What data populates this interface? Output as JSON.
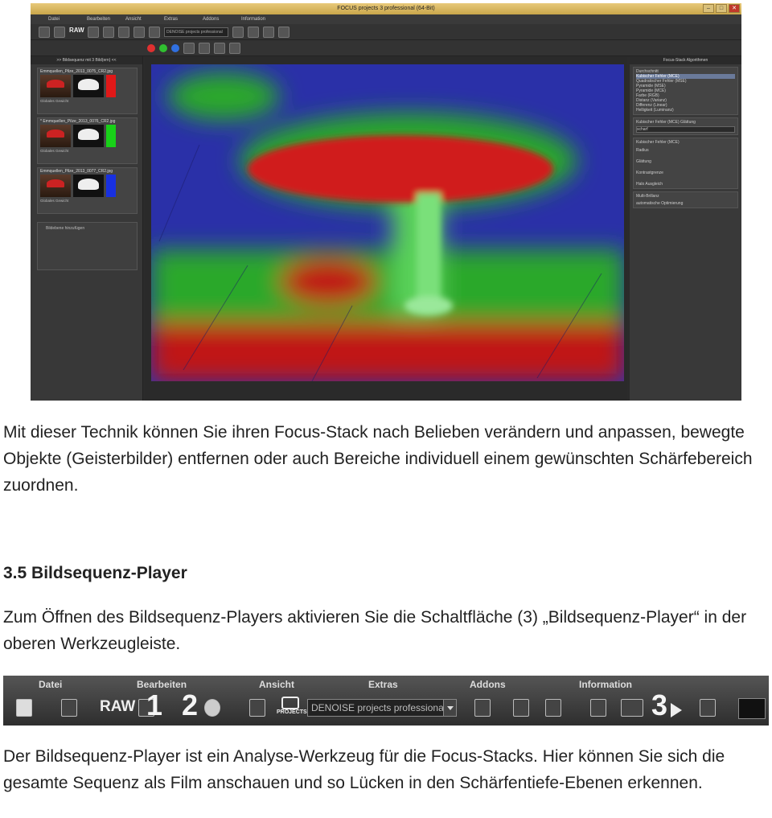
{
  "app": {
    "title": "FOCUS projects 3 professional (64-Bit)",
    "menu": [
      "Datei",
      "Bearbeiten",
      "Ansicht",
      "Extras",
      "Addons",
      "Information"
    ],
    "toolbar_raw": "RAW",
    "toolbar_denoise": "DENOISE projects professional",
    "left_panel_title": ">> Bildsequenz mit 3 Bild(ern) <<",
    "layers": [
      {
        "name": "Emmquellen_Pilze_2013_0075_CR2.jpg",
        "weight_label": "Globales Gewicht",
        "weight": "100",
        "left": "schwach",
        "right": "stark",
        "swatch": "#e01818"
      },
      {
        "name": "* Emmquellen_Pilze_2013_0076_CR2.jpg",
        "weight_label": "Globales Gewicht",
        "weight": "100",
        "left": "schwach",
        "right": "stark",
        "swatch": "#18d018"
      },
      {
        "name": "Emmquellen_Pilze_2013_0077_CR2.jpg",
        "weight_label": "Globales Gewicht",
        "weight": "100",
        "left": "schwach",
        "right": "stark",
        "swatch": "#1830e0"
      }
    ],
    "add_layer": "Bildebene hinzufügen",
    "right_panel_title": "Focus-Stack Algorithmen",
    "algorithms": [
      "Durchschnitt",
      "Kubischer Fehler (MCE)",
      "Quadratischer Fehler (MSE)",
      "Pyramide (MSE)",
      "Pyramide (MCE)",
      "Farbe (RGB)",
      "Distanz (Varianz)",
      "Differenz (Linear)",
      "Helligkeit (Luminanz)"
    ],
    "selected_algorithm": "Kubischer Fehler (MCE)",
    "smoothing_title": "Kubischer Fehler (MCE) Glättung",
    "smoothing_value": "scharf",
    "params_title": "Kubischer Fehler (MCE)",
    "params": [
      {
        "left": "niedrig",
        "label": "Radius",
        "value": "75",
        "unit": "px",
        "right": "hoch"
      },
      {
        "left": "hart",
        "label": "Glättung",
        "value": "25",
        "unit": "%",
        "right": "weich"
      },
      {
        "left": "gering",
        "label": "Kontrastgrenze",
        "value": "0",
        "unit": "",
        "right": "hoch"
      },
      {
        "left": "tief",
        "label": "Halo Ausgleich",
        "value": "0",
        "unit": "%",
        "right": "groß"
      }
    ],
    "brilliance_title": "Multi-Brillanz",
    "brilliance_option": "automatische Optimierung"
  },
  "text": {
    "para1": "Mit dieser Technik können Sie ihren Focus-Stack nach Belieben verändern und anpassen, bewegte Objekte (Geisterbilder) entfernen oder auch Bereiche individuell einem gewünschten Schärfebereich zuordnen.",
    "heading": "3.5 Bildsequenz-Player",
    "para2": "Zum Öffnen des Bildsequenz-Players aktivieren Sie die Schaltfläche (3) „Bildsequenz-Player“ in der oberen Werkzeugleiste.",
    "para3": "Der Bildsequenz-Player ist ein Analyse-Werkzeug für die Focus-Stacks. Hier können Sie sich die gesamte Sequenz als Film anschauen und so Lücken in den Schärfentiefe-Ebenen erkennen."
  },
  "toolbar_detail": {
    "menu": [
      "Datei",
      "Bearbeiten",
      "Ansicht",
      "Extras",
      "Addons",
      "Information"
    ],
    "raw": "RAW",
    "projects": "PROJECTS",
    "denoise": "DENOISE projects professional",
    "callouts": [
      "1",
      "2",
      "3"
    ]
  }
}
